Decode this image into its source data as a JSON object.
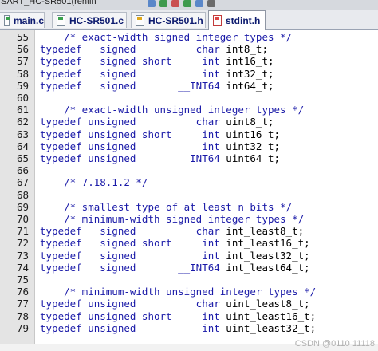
{
  "project": {
    "title": "SART_HC-SR501(rentin"
  },
  "tabs": [
    {
      "label": "main.c",
      "type": "c",
      "active": false
    },
    {
      "label": "HC-SR501.c",
      "type": "c",
      "active": false
    },
    {
      "label": "HC-SR501.h",
      "type": "h",
      "active": false
    },
    {
      "label": "stdint.h",
      "type": "h",
      "active": true
    }
  ],
  "lines": [
    {
      "num": "55",
      "text": "    /* exact-width signed integer types */"
    },
    {
      "num": "56",
      "text": "typedef   signed          char int8_t;"
    },
    {
      "num": "57",
      "text": "typedef   signed short     int int16_t;"
    },
    {
      "num": "58",
      "text": "typedef   signed           int int32_t;"
    },
    {
      "num": "59",
      "text": "typedef   signed       __INT64 int64_t;"
    },
    {
      "num": "60",
      "text": ""
    },
    {
      "num": "61",
      "text": "    /* exact-width unsigned integer types */"
    },
    {
      "num": "62",
      "text": "typedef unsigned          char uint8_t;"
    },
    {
      "num": "63",
      "text": "typedef unsigned short     int uint16_t;"
    },
    {
      "num": "64",
      "text": "typedef unsigned           int uint32_t;"
    },
    {
      "num": "65",
      "text": "typedef unsigned       __INT64 uint64_t;"
    },
    {
      "num": "66",
      "text": ""
    },
    {
      "num": "67",
      "text": "    /* 7.18.1.2 */"
    },
    {
      "num": "68",
      "text": ""
    },
    {
      "num": "69",
      "text": "    /* smallest type of at least n bits */"
    },
    {
      "num": "70",
      "text": "    /* minimum-width signed integer types */"
    },
    {
      "num": "71",
      "text": "typedef   signed          char int_least8_t;"
    },
    {
      "num": "72",
      "text": "typedef   signed short     int int_least16_t;"
    },
    {
      "num": "73",
      "text": "typedef   signed           int int_least32_t;"
    },
    {
      "num": "74",
      "text": "typedef   signed       __INT64 int_least64_t;"
    },
    {
      "num": "75",
      "text": ""
    },
    {
      "num": "76",
      "text": "    /* minimum-width unsigned integer types */"
    },
    {
      "num": "77",
      "text": "typedef unsigned          char uint_least8_t;"
    },
    {
      "num": "78",
      "text": "typedef unsigned short     int uint_least16_t;"
    },
    {
      "num": "79",
      "text": "typedef unsigned           int uint_least32_t;"
    }
  ],
  "watermark": "CSDN @0110 11118",
  "colors": {
    "keyword": "#1a1aa8",
    "comment": "#2222c8",
    "identifier": "#000000",
    "gutter": "#e4e4e4"
  },
  "icons": [
    "c-file-icon",
    "h-file-icon",
    "toolbar-icon"
  ]
}
